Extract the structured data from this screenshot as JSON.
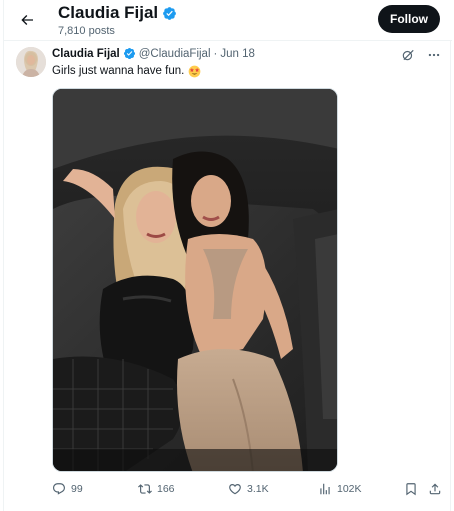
{
  "header": {
    "name": "Claudia Fijal",
    "post_count": "7,810 posts",
    "follow_label": "Follow"
  },
  "tweet": {
    "name": "Claudia Fijal",
    "handle": "@ClaudiaFijal",
    "separator": "·",
    "date": "Jun 18",
    "text": "Girls just wanna have fun.",
    "emoji": "star-struck-emoji",
    "media_alt": "photo-two-women-in-car-backseat"
  },
  "actions": {
    "replies": "99",
    "reposts": "166",
    "likes": "3.1K",
    "views": "102K"
  },
  "colors": {
    "text_primary": "#0f1419",
    "text_secondary": "#536471",
    "verified_blue": "#1d9bf0",
    "border": "#eff3f4"
  },
  "icons": [
    "back-arrow-icon",
    "verified-badge-icon",
    "grok-icon",
    "more-icon",
    "reply-icon",
    "repost-icon",
    "like-icon",
    "views-icon",
    "bookmark-icon",
    "share-icon"
  ]
}
